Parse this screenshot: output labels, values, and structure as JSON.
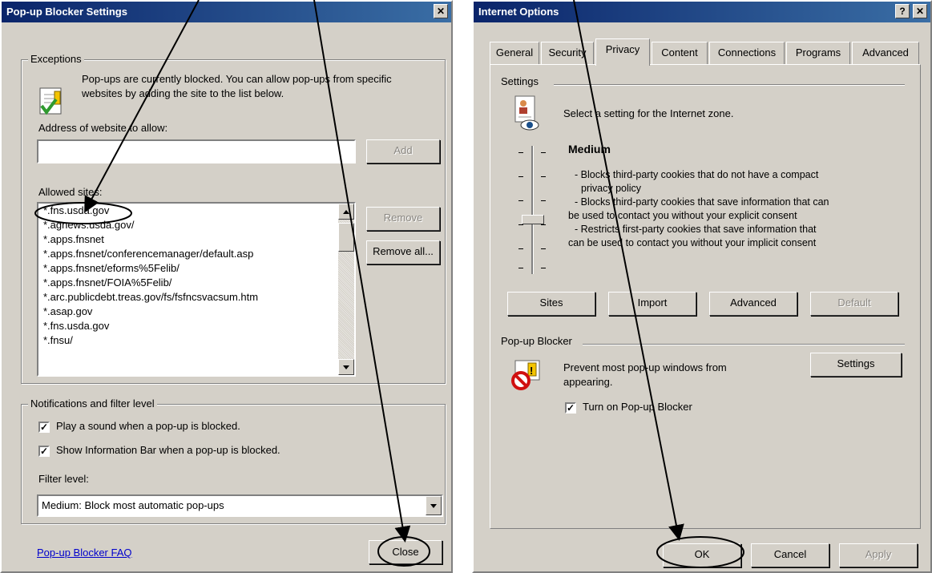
{
  "popup_dialog": {
    "title": "Pop-up Blocker Settings",
    "close_glyph": "✕",
    "exceptions": {
      "legend": "Exceptions",
      "info_line1": "Pop-ups are currently blocked.  You can allow pop-ups from specific",
      "info_line2": "websites by adding the site to the list below.",
      "address_label": "Address of website to allow:",
      "address_value": "",
      "add_label": "Add",
      "allowed_label": "Allowed sites:",
      "sites": [
        "*.fns.usda.gov",
        "*.agnews.usda.gov/",
        "*.apps.fnsnet",
        "*.apps.fnsnet/conferencemanager/default.asp",
        "*.apps.fnsnet/eforms%5Felib/",
        "*.apps.fnsnet/FOIA%5Felib/",
        "*.arc.publicdebt.treas.gov/fs/fsfncsvacsum.htm",
        "*.asap.gov",
        "*.fns.usda.gov",
        "*.fnsu/"
      ],
      "remove_label": "Remove",
      "remove_all_label": "Remove all..."
    },
    "notifications": {
      "legend": "Notifications and filter level",
      "play_sound_label": "Play a sound when a pop-up is blocked.",
      "info_bar_label": "Show Information Bar when a pop-up is blocked.",
      "filter_label": "Filter level:",
      "filter_value": "Medium: Block most automatic pop-ups"
    },
    "faq_link": "Pop-up Blocker FAQ",
    "close_label": "Close"
  },
  "options_dialog": {
    "title": "Internet Options",
    "help_glyph": "?",
    "close_glyph": "✕",
    "tabs": [
      "General",
      "Security",
      "Privacy",
      "Content",
      "Connections",
      "Programs",
      "Advanced"
    ],
    "settings": {
      "legend": "Settings",
      "intro": "Select a setting for the Internet zone.",
      "level": "Medium",
      "desc": [
        "- Blocks third-party cookies that do not have a compact",
        "privacy policy",
        "- Blocks third-party cookies that save information that can",
        "be used to contact you without your explicit consent",
        "- Restricts first-party cookies that save information that",
        "can be used to contact you without your implicit consent"
      ],
      "buttons": [
        "Sites",
        "Import",
        "Advanced",
        "Default"
      ]
    },
    "popup": {
      "legend": "Pop-up Blocker",
      "text_line1": "Prevent most pop-up windows from",
      "text_line2": "appearing.",
      "settings_label": "Settings",
      "turn_on_label": "Turn on Pop-up Blocker"
    },
    "ok_label": "OK",
    "cancel_label": "Cancel",
    "apply_label": "Apply"
  }
}
